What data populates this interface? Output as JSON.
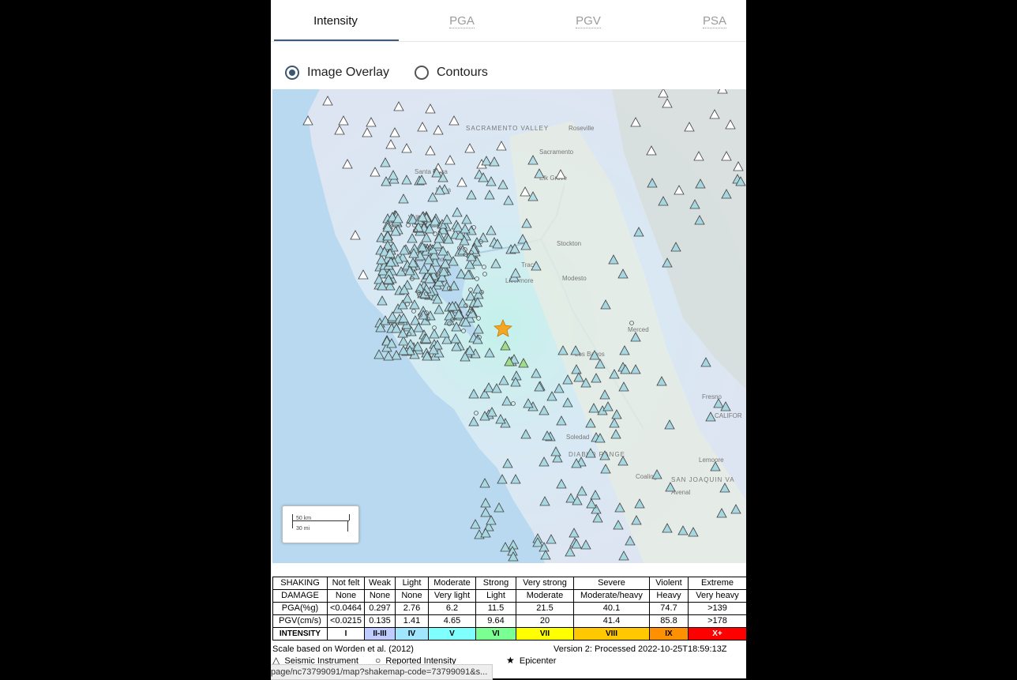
{
  "tabs": [
    {
      "label": "Intensity",
      "active": true
    },
    {
      "label": "PGA",
      "active": false
    },
    {
      "label": "PGV",
      "active": false
    },
    {
      "label": "PSA",
      "active": false
    }
  ],
  "overlay_options": [
    {
      "label": "Image Overlay",
      "checked": true
    },
    {
      "label": "Contours",
      "checked": false
    }
  ],
  "map": {
    "place_labels": [
      "Roseville",
      "Sacramento",
      "Elk Grove",
      "Vallejo",
      "Napa",
      "Santa Rosa",
      "Stockton",
      "Tracy",
      "Livermore",
      "Modesto",
      "Merced",
      "Los Banos",
      "Fresno",
      "Soledad",
      "Coalinga",
      "Avenal",
      "Lemoore",
      "San Francisco",
      "SACRAMENTO VALLEY",
      "SAN JOAQUIN VA",
      "CALIFOR",
      "DIABLO RANGE"
    ],
    "scale": {
      "km": "50 km",
      "mi": "30 mi"
    }
  },
  "legend": {
    "shaking": {
      "head": "SHAKING",
      "cells": [
        "Not felt",
        "Weak",
        "Light",
        "Moderate",
        "Strong",
        "Very strong",
        "Severe",
        "Violent",
        "Extreme"
      ]
    },
    "damage": {
      "head": "DAMAGE",
      "cells": [
        "None",
        "None",
        "None",
        "Very light",
        "Light",
        "Moderate",
        "Moderate/heavy",
        "Heavy",
        "Very heavy"
      ]
    },
    "pga": {
      "head": "PGA(%g)",
      "cells": [
        "<0.0464",
        "0.297",
        "2.76",
        "6.2",
        "11.5",
        "21.5",
        "40.1",
        "74.7",
        ">139"
      ]
    },
    "pgv": {
      "head": "PGV(cm/s)",
      "cells": [
        "<0.0215",
        "0.135",
        "1.41",
        "4.65",
        "9.64",
        "20",
        "41.4",
        "85.8",
        ">178"
      ]
    },
    "intensity": {
      "head": "INTENSITY",
      "cells": [
        "I",
        "II-III",
        "IV",
        "V",
        "VI",
        "VII",
        "VIII",
        "IX",
        "X+"
      ],
      "colors": [
        "#ffffff",
        "#bfccff",
        "#a0e6ff",
        "#80ffff",
        "#7aff93",
        "#ffff00",
        "#ffc800",
        "#ff9100",
        "#ff0000"
      ]
    }
  },
  "footer": {
    "scale_note": "Scale based on Worden et al. (2012)",
    "version": "Version 2: Processed 2022-10-25T18:59:13Z",
    "seismic": "Seismic Instrument",
    "reported": "Reported Intensity",
    "epicenter": "Epicenter"
  },
  "status_url": "page/nc73799091/map?shakemap-code=73799091&s..."
}
